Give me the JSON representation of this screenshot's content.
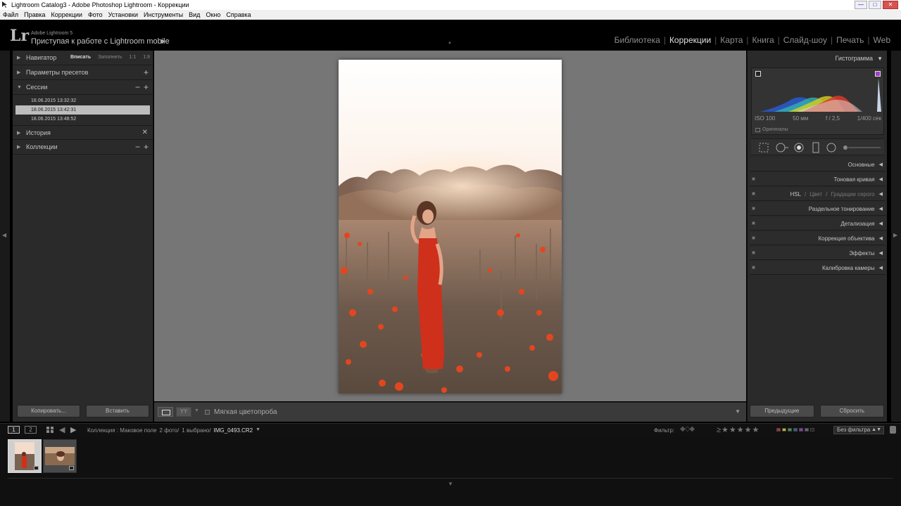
{
  "window": {
    "title": "Lightroom Catalog3 - Adobe Photoshop Lightroom - Коррекции",
    "minimize": "—",
    "maximize": "□",
    "close": "✕"
  },
  "menu": [
    "Файл",
    "Правка",
    "Коррекции",
    "Фото",
    "Установки",
    "Инструменты",
    "Вид",
    "Окно",
    "Справка"
  ],
  "lr": {
    "logo": "Lr",
    "version": "Adobe Lightroom 5",
    "mobile": "Приступая к работе с Lightroom mobile"
  },
  "modules": [
    "Библиотека",
    "Коррекции",
    "Карта",
    "Книга",
    "Слайд-шоу",
    "Печать",
    "Web"
  ],
  "active_module": "Коррекции",
  "left": {
    "navigator": {
      "label": "Навигатор",
      "opt_fit": "Вписать",
      "opt_fill": "Заполнить",
      "opt_1": "1:1",
      "opt_2": "1:8"
    },
    "presets": {
      "label": "Параметры пресетов"
    },
    "sessions": {
      "label": "Сессии",
      "items": [
        "18.06.2015 13:32:32",
        "18.06.2015 13:42:31",
        "18.06.2015 13:48:52"
      ],
      "selected": 1
    },
    "history": {
      "label": "История"
    },
    "collections": {
      "label": "Коллекции"
    },
    "copy": "Копировать...",
    "paste": "Вставить"
  },
  "toolbar": {
    "proof_label": "Мягкая цветопроба",
    "yy": "YY"
  },
  "right": {
    "histogram": "Гистограмма",
    "exif": {
      "iso": "ISO 100",
      "focal": "50 мм",
      "aperture": "f / 2,5",
      "shutter": "1/400 сек"
    },
    "originals": "Оригиналы",
    "sections": {
      "basic": "Основные",
      "tone": "Тоновая кривая",
      "hsl": "HSL",
      "color": "Цвет",
      "gray": "Градации серого",
      "split": "Раздельное тонирование",
      "detail": "Детализация",
      "lens": "Коррекция объектива",
      "effects": "Эффекты",
      "calib": "Калибровка камеры"
    },
    "previous": "Предыдущие",
    "reset": "Сбросить"
  },
  "filmstrip": {
    "num1": "1",
    "num2": "2",
    "path": "Коллекция : Маковое поле",
    "count": "2 фото/",
    "selected": "1 выбрано/",
    "file": "IMG_0493.CR2",
    "filter_label": "Фильтр:",
    "filter_value": "Без фильтра"
  },
  "colors": {
    "accent": "#e0e0e0",
    "panel": "#2a2a2a",
    "workspace": "#767676",
    "dress": "#d0321e",
    "label_red": "#b23030",
    "label_yellow": "#c8b030",
    "label_green": "#3c9a3c",
    "label_blue": "#3a58b0",
    "label_purple": "#8a3ab0"
  },
  "icons": [
    "lr-app-icon",
    "triangle-right-icon",
    "triangle-down-icon",
    "plus-icon",
    "minus-icon",
    "close-icon",
    "crop-overlay-icon",
    "spot-removal-icon",
    "red-eye-icon",
    "graduated-filter-icon",
    "radial-filter-icon",
    "adjustment-brush-icon",
    "grid-icon",
    "arrow-left-icon",
    "arrow-right-icon",
    "star-icon",
    "flag-icon",
    "lock-icon"
  ]
}
